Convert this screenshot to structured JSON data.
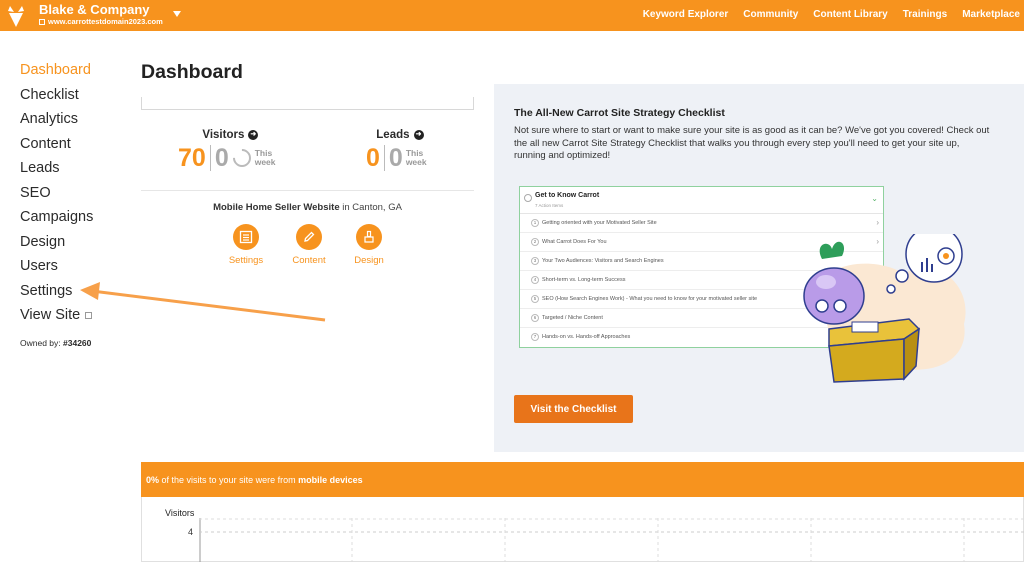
{
  "header": {
    "company_name": "Blake & Company",
    "site_url": "www.carrottestdomain2023.com",
    "nav": [
      "Keyword Explorer",
      "Community",
      "Content Library",
      "Trainings",
      "Marketplace"
    ]
  },
  "sidebar": {
    "items": [
      {
        "label": "Dashboard",
        "active": true
      },
      {
        "label": "Checklist"
      },
      {
        "label": "Analytics"
      },
      {
        "label": "Content"
      },
      {
        "label": "Leads"
      },
      {
        "label": "SEO"
      },
      {
        "label": "Campaigns"
      },
      {
        "label": "Design"
      },
      {
        "label": "Users"
      },
      {
        "label": "Settings"
      },
      {
        "label": "View Site",
        "external": true
      }
    ],
    "owned_by_label": "Owned by:",
    "owned_by_id": "#34260"
  },
  "main": {
    "title": "Dashboard",
    "visitors": {
      "label": "Visitors",
      "total": "70",
      "this_week": "0",
      "this_week_label": "This week"
    },
    "leads": {
      "label": "Leads",
      "total": "0",
      "this_week": "0",
      "this_week_label": "This week"
    },
    "site_name": "Mobile Home Seller Website",
    "site_location": "in Canton, GA",
    "quick_actions": [
      {
        "label": "Settings",
        "icon": "settings-list-icon"
      },
      {
        "label": "Content",
        "icon": "pencil-icon"
      },
      {
        "label": "Design",
        "icon": "paint-brush-icon"
      }
    ]
  },
  "promo": {
    "title": "The All-New Carrot Site Strategy Checklist",
    "description": "Not sure where to start or want to make sure your site is as good as it can be? We've got you covered! Check out the all new Carrot Site Strategy Checklist that walks you through every step you'll need to get your site up, running and optimized!",
    "preview": {
      "heading": "Get to Know Carrot",
      "subheading": "7 Action Items",
      "items": [
        "Getting oriented with your Motivated Seller Site",
        "What Carrot Does For You",
        "Your Two Audiences: Visitors and Search Engines",
        "Short-term vs. Long-term Success",
        "SEO (How Search Engines Work) - What you need to know for your motivated seller site",
        "Targeted / Niche Content",
        "Hands-on vs. Hands-off Approaches"
      ]
    },
    "cta_label": "Visit the Checklist"
  },
  "mobile": {
    "percent": "0%",
    "text_middle": "of the visits to your site were from",
    "text_bold": "mobile devices",
    "chart_ylabel": "Visitors",
    "chart_tick": "4"
  },
  "colors": {
    "brand": "#f7931e",
    "cta": "#e8741a",
    "panel": "#eef1f6"
  }
}
